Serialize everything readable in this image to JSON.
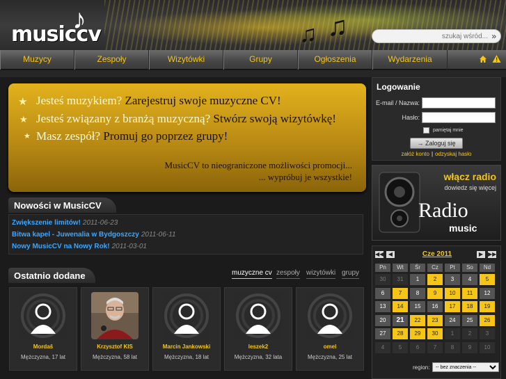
{
  "brand": {
    "logo_text": "music",
    "logo_cv": "cv"
  },
  "search": {
    "placeholder": "szukaj wśród...",
    "button": "»"
  },
  "nav": {
    "tabs": [
      "Muzycy",
      "Zespoły",
      "Wizytówki",
      "Grupy",
      "Ogłoszenia",
      "Wydarzenia"
    ]
  },
  "promo": {
    "lines": [
      {
        "question": "Jesteś muzykiem?",
        "action": "Zarejestruj swoje muzyczne CV!"
      },
      {
        "question": "Jesteś związany z branżą muzyczną?",
        "action": "Stwórz swoją wizytówkę!"
      },
      {
        "question": "Masz zespół?",
        "action": "Promuj go poprzez grupy!"
      }
    ],
    "tagline1": "MusicCV to nieograniczone możliwości promocji...",
    "tagline2": "... wypróbuj je wszystkie!"
  },
  "news": {
    "title": "Nowości w MusicCV",
    "items": [
      {
        "title": "Zwiększenie limitów!",
        "date": "2011-06-23"
      },
      {
        "title": "Bitwa kapel - Juwenalia w Bydgoszczy",
        "date": "2011-06-11"
      },
      {
        "title": "Nowy MusicCV na Nowy Rok!",
        "date": "2011-03-01"
      }
    ]
  },
  "recent": {
    "title": "Ostatnio dodane",
    "tabs": [
      "muzyczne cv",
      "zespoły",
      "wizytówki",
      "grupy"
    ],
    "active_tab": "muzyczne cv",
    "cards": [
      {
        "name": "Mordaš",
        "info": "Mężczyzna, 17 lat"
      },
      {
        "name": "Krzysztof KIS",
        "info": "Mężczyzna, 58 lat"
      },
      {
        "name": "Marcin Jankowski",
        "info": "Mężczyzna, 18 lat"
      },
      {
        "name": "leszek2",
        "info": "Mężczyzna, 32 lata"
      },
      {
        "name": "omel",
        "info": "Mężczyzna, 25 lat"
      }
    ]
  },
  "login": {
    "title": "Logowanie",
    "email_label": "E-mail / Nazwa:",
    "password_label": "Hasło:",
    "remember_label": "pamiętaj mnie",
    "submit": "Zaloguj się",
    "register_link": "załóż konto",
    "separator": "|",
    "recover_link": "odzyskaj hasło"
  },
  "radio": {
    "on_label": "włącz radio",
    "more_label": "dowiedz się więcej",
    "logo_word": "Radio",
    "logo_brand": "music"
  },
  "calendar": {
    "month_label": "Cze 2011",
    "weekdays": [
      "Pn",
      "Wt",
      "Śr",
      "Cz",
      "Pt",
      "So",
      "Nd"
    ],
    "rows": [
      [
        [
          "30",
          "oth"
        ],
        [
          "31",
          "oth"
        ],
        [
          "1",
          "cur"
        ],
        [
          "2",
          "evt"
        ],
        [
          "3",
          "cur"
        ],
        [
          "4",
          "cur"
        ],
        [
          "5",
          "evt"
        ]
      ],
      [
        [
          "6",
          "cur"
        ],
        [
          "7",
          "evt"
        ],
        [
          "8",
          "cur"
        ],
        [
          "9",
          "evt"
        ],
        [
          "10",
          "evt"
        ],
        [
          "11",
          "evt"
        ],
        [
          "12",
          "cur"
        ]
      ],
      [
        [
          "13",
          "cur"
        ],
        [
          "14",
          "evt"
        ],
        [
          "15",
          "cur"
        ],
        [
          "16",
          "cur"
        ],
        [
          "17",
          "evt"
        ],
        [
          "18",
          "evt"
        ],
        [
          "19",
          "evt"
        ]
      ],
      [
        [
          "20",
          "cur"
        ],
        [
          "21",
          "tod"
        ],
        [
          "22",
          "evt"
        ],
        [
          "23",
          "evt"
        ],
        [
          "24",
          "cur"
        ],
        [
          "25",
          "cur"
        ],
        [
          "26",
          "evt"
        ]
      ],
      [
        [
          "27",
          "cur"
        ],
        [
          "28",
          "evt"
        ],
        [
          "29",
          "evt"
        ],
        [
          "30",
          "evt"
        ],
        [
          "1",
          "oth"
        ],
        [
          "2",
          "oth"
        ],
        [
          "3",
          "oth"
        ]
      ],
      [
        [
          "4",
          "oth"
        ],
        [
          "5",
          "oth"
        ],
        [
          "6",
          "oth"
        ],
        [
          "7",
          "oth"
        ],
        [
          "8",
          "oth"
        ],
        [
          "9",
          "oth"
        ],
        [
          "10",
          "oth"
        ]
      ]
    ],
    "region_label": "region:",
    "region_value": "-- bez znaczenia --"
  },
  "colors": {
    "accent": "#f5c518",
    "link": "#3ba7ff",
    "event": "#f5c518"
  }
}
